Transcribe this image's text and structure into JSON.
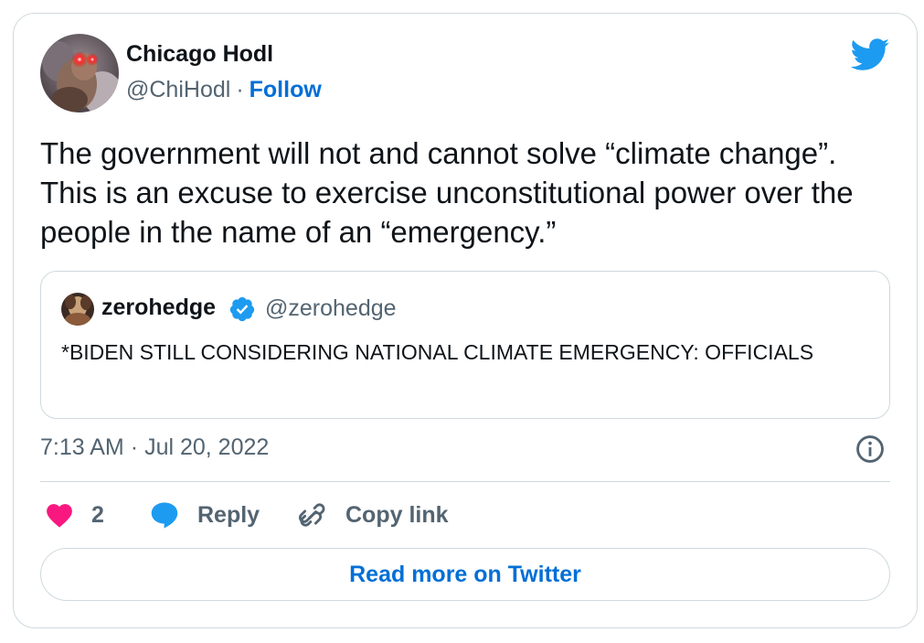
{
  "tweet": {
    "author": {
      "name": "Chicago Hodl",
      "handle": "@ChiHodl",
      "separator": "·",
      "follow_label": "Follow"
    },
    "text": "The government will not and cannot solve “climate change”. This is an excuse to exercise unconstitutional power over the people in the name of an “emergency.”",
    "quoted": {
      "name": "zerohedge",
      "verified": true,
      "handle": "@zerohedge",
      "text": "*BIDEN STILL CONSIDERING NATIONAL CLIMATE EMERGENCY: OFFICIALS"
    },
    "time": "7:13 AM",
    "date_separator": "·",
    "date": "Jul 20, 2022",
    "actions": {
      "likes_count": "2",
      "reply_label": "Reply",
      "copy_link_label": "Copy link"
    },
    "read_more_label": "Read more on Twitter"
  },
  "icons": {
    "brand": "twitter-bird-icon",
    "like": "heart-icon",
    "reply": "speech-bubble-icon",
    "copy": "link-icon",
    "info": "info-icon",
    "verified": "verified-badge-icon"
  },
  "colors": {
    "twitter_blue": "#1d9bf0",
    "link_blue": "#006fd6",
    "heart_pink": "#f91880",
    "secondary_text": "#536471",
    "primary_text": "#0f1419",
    "border": "#cfd9de"
  }
}
